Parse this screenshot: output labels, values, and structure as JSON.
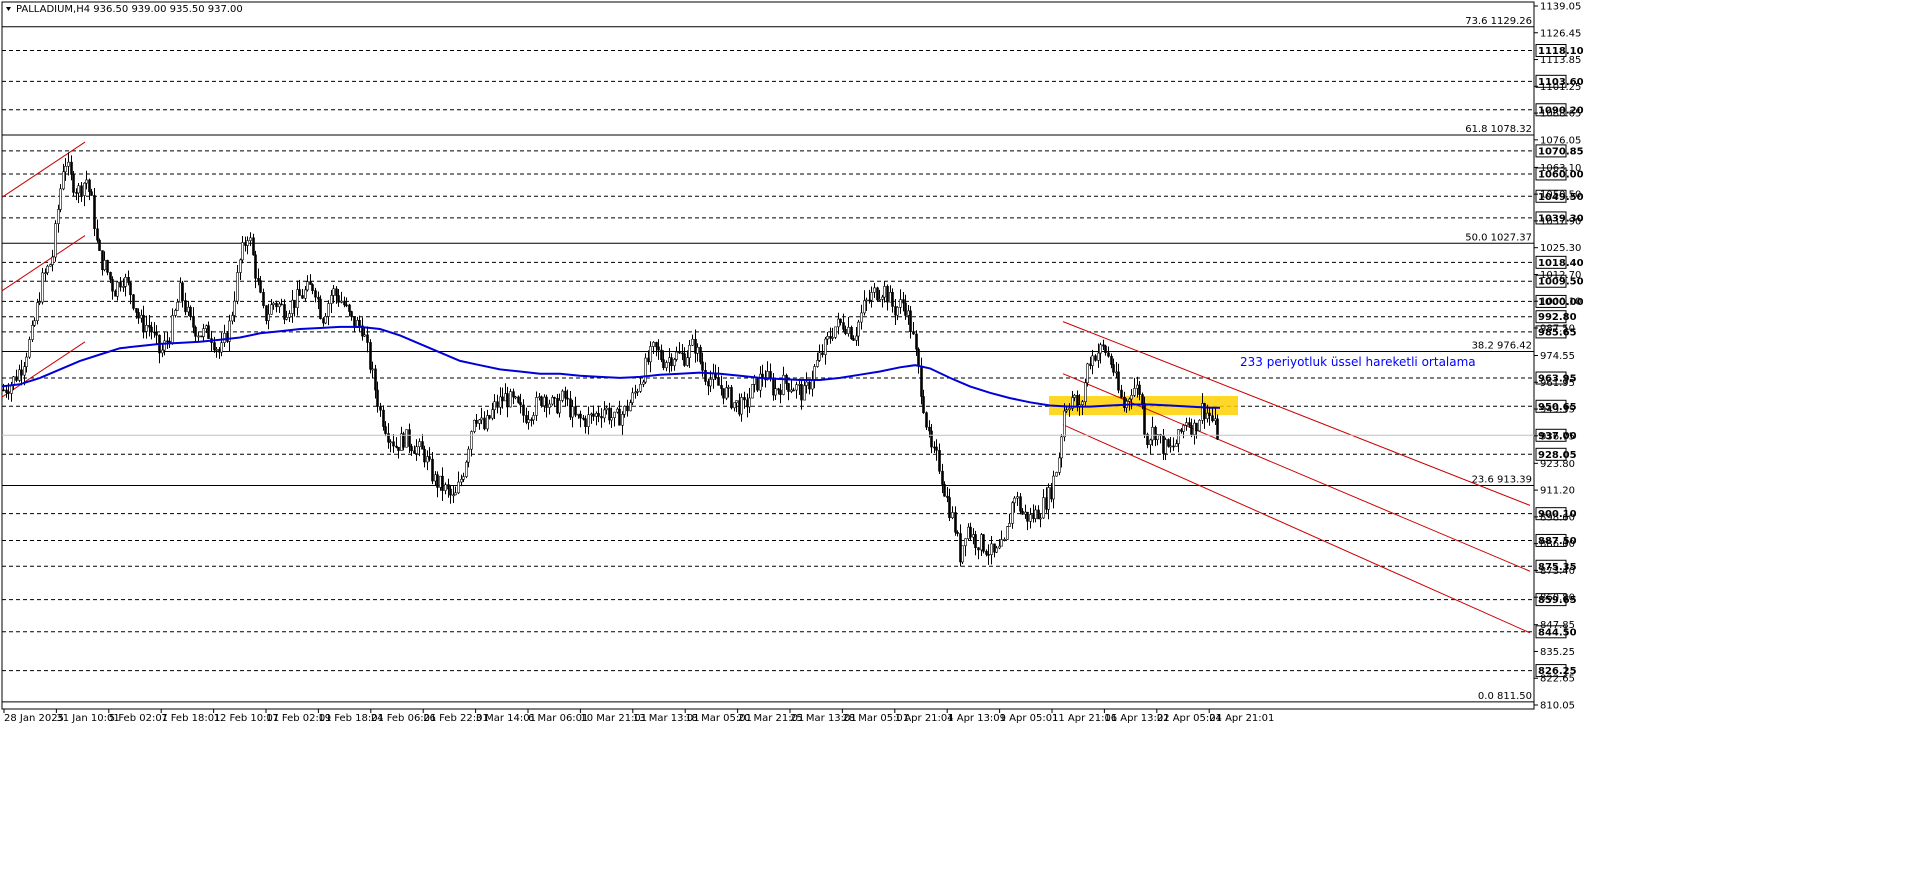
{
  "chart_data": {
    "type": "candlestick",
    "symbol": "PALLADIUM",
    "timeframe": "H4",
    "header": {
      "menu_icon": "triangle-down-icon",
      "text": "PALLADIUM,H4  936.50 939.00 935.50 937.00"
    },
    "ohlc": {
      "open": 936.5,
      "high": 939.0,
      "low": 935.5,
      "close": 937.0
    },
    "current_price": 937.0,
    "ylim": [
      811.5,
      1139.05
    ],
    "y_ticks": [
      1139.05,
      1126.45,
      1113.85,
      1101.25,
      1088.65,
      1076.05,
      1063.1,
      1050.5,
      1037.9,
      1025.3,
      1012.7,
      1000.1,
      987.5,
      974.55,
      961.95,
      949.35,
      936.75,
      923.8,
      911.2,
      898.6,
      886.0,
      873.4,
      860.8,
      847.85,
      835.25,
      822.65,
      810.05
    ],
    "y_tick_labels": [
      "1139.05",
      "1126.45",
      "1113.85",
      "1101.25",
      "1088.65",
      "1076.05",
      "1063.10",
      "1050.50",
      "1037.90",
      "1025.30",
      "1012.70",
      "1000.10",
      "987.50",
      "974.55",
      "961.95",
      "949.35",
      "936.75",
      "923.80",
      "911.20",
      "898.60",
      "886.00",
      "873.40",
      "860.80",
      "847.85",
      "835.25",
      "822.65",
      "810.05"
    ],
    "x_tick_labels": [
      "28 Jan 2025",
      "31 Jan 10:01",
      "5 Feb 02:01",
      "7 Feb 18:01",
      "12 Feb 10:01",
      "17 Feb 02:01",
      "19 Feb 18:01",
      "24 Feb 06:01",
      "26 Feb 22:01",
      "3 Mar 14:01",
      "6 Mar 06:01",
      "10 Mar 21:01",
      "13 Mar 13:01",
      "18 Mar 05:01",
      "20 Mar 21:01",
      "25 Mar 13:01",
      "28 Mar 05:01",
      "1 Apr 21:01",
      "4 Apr 13:01",
      "9 Apr 05:01",
      "11 Apr 21:01",
      "16 Apr 13:01",
      "22 Apr 05:01",
      "24 Apr 21:01"
    ],
    "horizontal_levels": [
      {
        "value": 1118.1,
        "label": "1118.10"
      },
      {
        "value": 1103.6,
        "label": "1103.60"
      },
      {
        "value": 1090.2,
        "label": "1090.20"
      },
      {
        "value": 1070.85,
        "label": "1070.85"
      },
      {
        "value": 1060.0,
        "label": "1060.00"
      },
      {
        "value": 1049.5,
        "label": "1049.50"
      },
      {
        "value": 1039.3,
        "label": "1039.30"
      },
      {
        "value": 1018.4,
        "label": "1018.40"
      },
      {
        "value": 1009.5,
        "label": "1009.50"
      },
      {
        "value": 1000.0,
        "label": "1000.00"
      },
      {
        "value": 992.8,
        "label": "992.80"
      },
      {
        "value": 985.65,
        "label": "985.65"
      },
      {
        "value": 963.95,
        "label": "963.95"
      },
      {
        "value": 950.65,
        "label": "950.65"
      },
      {
        "value": 928.05,
        "label": "928.05"
      },
      {
        "value": 900.1,
        "label": "900.10"
      },
      {
        "value": 887.5,
        "label": "887.50"
      },
      {
        "value": 875.35,
        "label": "875.35"
      },
      {
        "value": 859.65,
        "label": "859.65"
      },
      {
        "value": 844.5,
        "label": "844.50"
      },
      {
        "value": 826.25,
        "label": "826.25"
      }
    ],
    "fibonacci": [
      {
        "level": "73.6",
        "value": 1129.26,
        "label": "73.6 1129.26"
      },
      {
        "level": "61.8",
        "value": 1078.32,
        "label": "61.8 1078.32"
      },
      {
        "level": "50.0",
        "value": 1027.37,
        "label": "50.0 1027.37"
      },
      {
        "level": "38.2",
        "value": 976.42,
        "label": "38.2 976.42"
      },
      {
        "level": "23.6",
        "value": 913.39,
        "label": "23.6 913.39"
      },
      {
        "level": "0.0",
        "value": 811.5,
        "label": "0.0 811.50"
      }
    ],
    "ema_annotation": "233 periyotluk üssel hareketli ortalama",
    "ema_path": [
      {
        "x": 2,
        "y": 960
      },
      {
        "x": 20,
        "y": 961
      },
      {
        "x": 40,
        "y": 964
      },
      {
        "x": 60,
        "y": 968
      },
      {
        "x": 80,
        "y": 972
      },
      {
        "x": 100,
        "y": 975
      },
      {
        "x": 120,
        "y": 978
      },
      {
        "x": 140,
        "y": 979
      },
      {
        "x": 160,
        "y": 980
      },
      {
        "x": 180,
        "y": 980.5
      },
      {
        "x": 200,
        "y": 981
      },
      {
        "x": 220,
        "y": 982
      },
      {
        "x": 240,
        "y": 983
      },
      {
        "x": 260,
        "y": 985
      },
      {
        "x": 280,
        "y": 986
      },
      {
        "x": 300,
        "y": 987
      },
      {
        "x": 320,
        "y": 987.5
      },
      {
        "x": 340,
        "y": 988
      },
      {
        "x": 360,
        "y": 988
      },
      {
        "x": 380,
        "y": 987
      },
      {
        "x": 400,
        "y": 984
      },
      {
        "x": 420,
        "y": 980
      },
      {
        "x": 440,
        "y": 976
      },
      {
        "x": 460,
        "y": 972
      },
      {
        "x": 480,
        "y": 970
      },
      {
        "x": 500,
        "y": 968
      },
      {
        "x": 520,
        "y": 967
      },
      {
        "x": 540,
        "y": 966
      },
      {
        "x": 560,
        "y": 966
      },
      {
        "x": 580,
        "y": 965
      },
      {
        "x": 600,
        "y": 964.5
      },
      {
        "x": 620,
        "y": 964
      },
      {
        "x": 640,
        "y": 964.5
      },
      {
        "x": 660,
        "y": 965.5
      },
      {
        "x": 680,
        "y": 966
      },
      {
        "x": 700,
        "y": 966.5
      },
      {
        "x": 720,
        "y": 966
      },
      {
        "x": 740,
        "y": 965
      },
      {
        "x": 760,
        "y": 964
      },
      {
        "x": 780,
        "y": 963.5
      },
      {
        "x": 800,
        "y": 963
      },
      {
        "x": 820,
        "y": 963
      },
      {
        "x": 840,
        "y": 964
      },
      {
        "x": 860,
        "y": 965.5
      },
      {
        "x": 880,
        "y": 967
      },
      {
        "x": 900,
        "y": 969
      },
      {
        "x": 915,
        "y": 970
      },
      {
        "x": 930,
        "y": 968.5
      },
      {
        "x": 950,
        "y": 964
      },
      {
        "x": 970,
        "y": 960
      },
      {
        "x": 990,
        "y": 957
      },
      {
        "x": 1010,
        "y": 954.5
      },
      {
        "x": 1030,
        "y": 952.5
      },
      {
        "x": 1050,
        "y": 951
      },
      {
        "x": 1070,
        "y": 950.5
      },
      {
        "x": 1090,
        "y": 950.5
      },
      {
        "x": 1110,
        "y": 951
      },
      {
        "x": 1130,
        "y": 951.5
      },
      {
        "x": 1150,
        "y": 951.5
      },
      {
        "x": 1170,
        "y": 951
      },
      {
        "x": 1190,
        "y": 950.5
      },
      {
        "x": 1210,
        "y": 950
      },
      {
        "x": 1220,
        "y": 950
      }
    ],
    "highlight_zone": {
      "x_start": 1049,
      "x_end": 1238,
      "y_low": 946.5,
      "y_high": 955.5,
      "color": "#ffd000"
    },
    "channels": [
      {
        "name": "early-channel-upper",
        "x1": 2,
        "y1": 1049.0,
        "x2": 85,
        "y2": 1075.0
      },
      {
        "name": "early-channel-lower",
        "x1": 2,
        "y1": 1005.0,
        "x2": 85,
        "y2": 1031.0
      },
      {
        "name": "early-channel-bottom",
        "x1": 2,
        "y1": 955.0,
        "x2": 85,
        "y2": 981.0
      },
      {
        "name": "falling-channel-upper",
        "x1": 1063,
        "y1": 990.5,
        "x2": 1530,
        "y2": 904.0
      },
      {
        "name": "falling-channel-middle",
        "x1": 1063,
        "y1": 966.0,
        "x2": 1530,
        "y2": 873.0
      },
      {
        "name": "falling-channel-lower",
        "x1": 1063,
        "y1": 942.0,
        "x2": 1530,
        "y2": 844.0
      }
    ],
    "price_path": [
      {
        "x": 2,
        "v": 958
      },
      {
        "x": 12,
        "v": 962
      },
      {
        "x": 22,
        "v": 970
      },
      {
        "x": 32,
        "v": 985
      },
      {
        "x": 42,
        "v": 1010
      },
      {
        "x": 52,
        "v": 1020
      },
      {
        "x": 58,
        "v": 1045
      },
      {
        "x": 64,
        "v": 1068
      },
      {
        "x": 70,
        "v": 1058
      },
      {
        "x": 78,
        "v": 1052
      },
      {
        "x": 86,
        "v": 1058
      },
      {
        "x": 92,
        "v": 1045
      },
      {
        "x": 98,
        "v": 1022
      },
      {
        "x": 106,
        "v": 1015
      },
      {
        "x": 114,
        "v": 1005
      },
      {
        "x": 122,
        "v": 1012
      },
      {
        "x": 130,
        "v": 1005
      },
      {
        "x": 140,
        "v": 990
      },
      {
        "x": 150,
        "v": 988
      },
      {
        "x": 160,
        "v": 975
      },
      {
        "x": 170,
        "v": 985
      },
      {
        "x": 180,
        "v": 1005
      },
      {
        "x": 190,
        "v": 990
      },
      {
        "x": 200,
        "v": 985
      },
      {
        "x": 210,
        "v": 985
      },
      {
        "x": 220,
        "v": 975
      },
      {
        "x": 230,
        "v": 990
      },
      {
        "x": 240,
        "v": 1020
      },
      {
        "x": 248,
        "v": 1033
      },
      {
        "x": 256,
        "v": 1012
      },
      {
        "x": 264,
        "v": 992
      },
      {
        "x": 274,
        "v": 1000
      },
      {
        "x": 284,
        "v": 996
      },
      {
        "x": 294,
        "v": 1000
      },
      {
        "x": 304,
        "v": 1004
      },
      {
        "x": 314,
        "v": 1008
      },
      {
        "x": 322,
        "v": 992
      },
      {
        "x": 332,
        "v": 1005
      },
      {
        "x": 342,
        "v": 1000
      },
      {
        "x": 352,
        "v": 990
      },
      {
        "x": 362,
        "v": 988
      },
      {
        "x": 372,
        "v": 965
      },
      {
        "x": 380,
        "v": 948
      },
      {
        "x": 388,
        "v": 938
      },
      {
        "x": 396,
        "v": 932
      },
      {
        "x": 404,
        "v": 936
      },
      {
        "x": 414,
        "v": 932
      },
      {
        "x": 424,
        "v": 928
      },
      {
        "x": 434,
        "v": 916
      },
      {
        "x": 444,
        "v": 912
      },
      {
        "x": 454,
        "v": 906
      },
      {
        "x": 464,
        "v": 922
      },
      {
        "x": 474,
        "v": 948
      },
      {
        "x": 484,
        "v": 940
      },
      {
        "x": 494,
        "v": 950
      },
      {
        "x": 504,
        "v": 955
      },
      {
        "x": 514,
        "v": 952
      },
      {
        "x": 524,
        "v": 946
      },
      {
        "x": 534,
        "v": 950
      },
      {
        "x": 544,
        "v": 956
      },
      {
        "x": 554,
        "v": 950
      },
      {
        "x": 564,
        "v": 955
      },
      {
        "x": 574,
        "v": 945
      },
      {
        "x": 584,
        "v": 944
      },
      {
        "x": 594,
        "v": 946
      },
      {
        "x": 604,
        "v": 950
      },
      {
        "x": 614,
        "v": 944
      },
      {
        "x": 624,
        "v": 948
      },
      {
        "x": 634,
        "v": 956
      },
      {
        "x": 644,
        "v": 968
      },
      {
        "x": 654,
        "v": 978
      },
      {
        "x": 664,
        "v": 972
      },
      {
        "x": 674,
        "v": 975
      },
      {
        "x": 684,
        "v": 974
      },
      {
        "x": 694,
        "v": 980
      },
      {
        "x": 704,
        "v": 966
      },
      {
        "x": 714,
        "v": 962
      },
      {
        "x": 724,
        "v": 958
      },
      {
        "x": 734,
        "v": 952
      },
      {
        "x": 744,
        "v": 950
      },
      {
        "x": 754,
        "v": 960
      },
      {
        "x": 764,
        "v": 966
      },
      {
        "x": 774,
        "v": 958
      },
      {
        "x": 784,
        "v": 962
      },
      {
        "x": 794,
        "v": 960
      },
      {
        "x": 804,
        "v": 956
      },
      {
        "x": 814,
        "v": 968
      },
      {
        "x": 824,
        "v": 978
      },
      {
        "x": 834,
        "v": 988
      },
      {
        "x": 844,
        "v": 990
      },
      {
        "x": 854,
        "v": 984
      },
      {
        "x": 864,
        "v": 998
      },
      {
        "x": 874,
        "v": 1004
      },
      {
        "x": 884,
        "v": 1006
      },
      {
        "x": 894,
        "v": 996
      },
      {
        "x": 904,
        "v": 1000
      },
      {
        "x": 912,
        "v": 985
      },
      {
        "x": 918,
        "v": 968
      },
      {
        "x": 924,
        "v": 950
      },
      {
        "x": 930,
        "v": 930
      },
      {
        "x": 938,
        "v": 925
      },
      {
        "x": 946,
        "v": 908
      },
      {
        "x": 954,
        "v": 895
      },
      {
        "x": 960,
        "v": 880
      },
      {
        "x": 966,
        "v": 895
      },
      {
        "x": 974,
        "v": 888
      },
      {
        "x": 984,
        "v": 885
      },
      {
        "x": 994,
        "v": 880
      },
      {
        "x": 1004,
        "v": 885
      },
      {
        "x": 1014,
        "v": 910
      },
      {
        "x": 1022,
        "v": 900
      },
      {
        "x": 1030,
        "v": 898
      },
      {
        "x": 1040,
        "v": 902
      },
      {
        "x": 1050,
        "v": 910
      },
      {
        "x": 1058,
        "v": 925
      },
      {
        "x": 1064,
        "v": 950
      },
      {
        "x": 1072,
        "v": 955
      },
      {
        "x": 1080,
        "v": 948
      },
      {
        "x": 1088,
        "v": 972
      },
      {
        "x": 1096,
        "v": 976
      },
      {
        "x": 1104,
        "v": 978
      },
      {
        "x": 1112,
        "v": 970
      },
      {
        "x": 1118,
        "v": 958
      },
      {
        "x": 1124,
        "v": 950
      },
      {
        "x": 1132,
        "v": 960
      },
      {
        "x": 1140,
        "v": 958
      },
      {
        "x": 1146,
        "v": 935
      },
      {
        "x": 1154,
        "v": 940
      },
      {
        "x": 1162,
        "v": 932
      },
      {
        "x": 1170,
        "v": 930
      },
      {
        "x": 1178,
        "v": 935
      },
      {
        "x": 1186,
        "v": 945
      },
      {
        "x": 1194,
        "v": 940
      },
      {
        "x": 1202,
        "v": 950
      },
      {
        "x": 1210,
        "v": 946
      },
      {
        "x": 1218,
        "v": 937
      }
    ]
  }
}
